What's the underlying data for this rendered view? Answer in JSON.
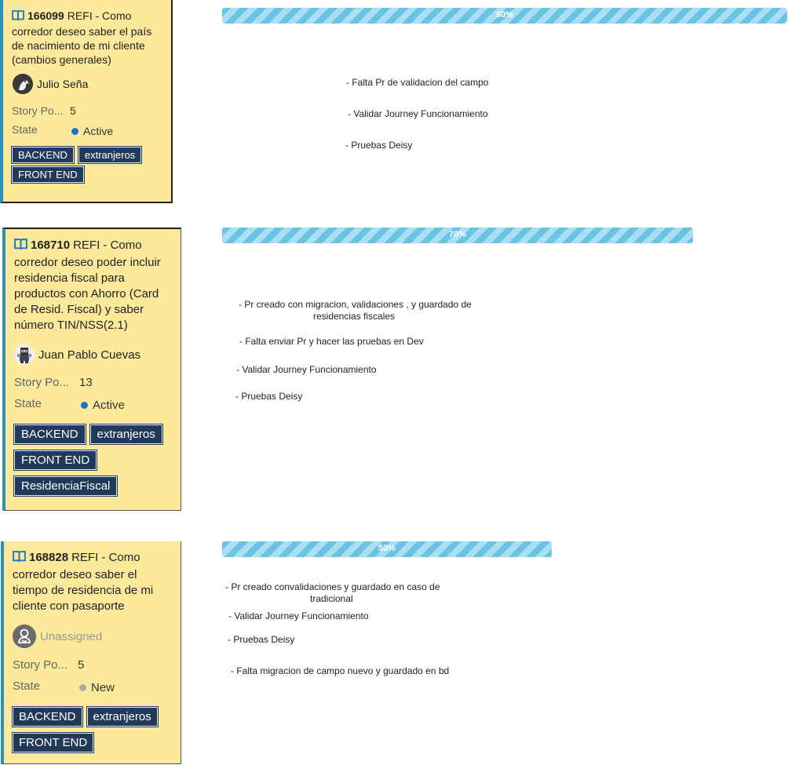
{
  "cards": [
    {
      "id": "166099",
      "title": "REFI - Como corredor deseo saber el país de nacimiento de mi cliente (cambios generales)",
      "assignee": "Julio Seña",
      "story_points_label": "Story Po...",
      "story_points": "5",
      "state_label": "State",
      "state": "Active",
      "state_color": "#1a73c8",
      "tags": [
        "BACKEND",
        "extranjeros",
        "FRONT END"
      ],
      "progress_label": "90%",
      "progress": 0.9,
      "notes": [
        "- Falta Pr de validacion del campo",
        "- Validar Journey Funcionamiento",
        "- Pruebas Deisy"
      ]
    },
    {
      "id": "168710",
      "title": "REFI - Como corredor deseo poder incluir residencia fiscal para productos con Ahorro (Card de Resid. Fiscal) y saber número TIN/NSS(2.1)",
      "assignee": "Juan Pablo Cuevas",
      "story_points_label": "Story Po...",
      "story_points": "13",
      "state_label": "State",
      "state": "Active",
      "state_color": "#1a73c8",
      "tags": [
        "BACKEND",
        "extranjeros",
        "FRONT END",
        "ResidenciaFiscal"
      ],
      "progress_label": "70%",
      "progress": 0.7,
      "notes": [
        "- Pr creado con migracion, validaciones , y guardado de",
        "residencias fiscales",
        "- Falta enviar Pr y hacer las pruebas en Dev",
        "- Validar Journey Funcionamiento",
        "- Pruebas Deisy"
      ]
    },
    {
      "id": "168828",
      "title": "REFI - Como corredor deseo saber el tiempo de residencia de mi cliente con pasaporte",
      "assignee": "Unassigned",
      "story_points_label": "Story Po...",
      "story_points": "5",
      "state_label": "State",
      "state": "New",
      "state_color": "#aaaaaa",
      "tags": [
        "BACKEND",
        "extranjeros",
        "FRONT END"
      ],
      "progress_label": "50%",
      "progress": 0.5,
      "notes": [
        "- Pr creado convalidaciones y guardado en caso de",
        "tradicional",
        "- Validar Journey Funcionamiento",
        "- Pruebas Deisy",
        "- Falta migracion de campo nuevo y guardado en bd"
      ]
    }
  ]
}
